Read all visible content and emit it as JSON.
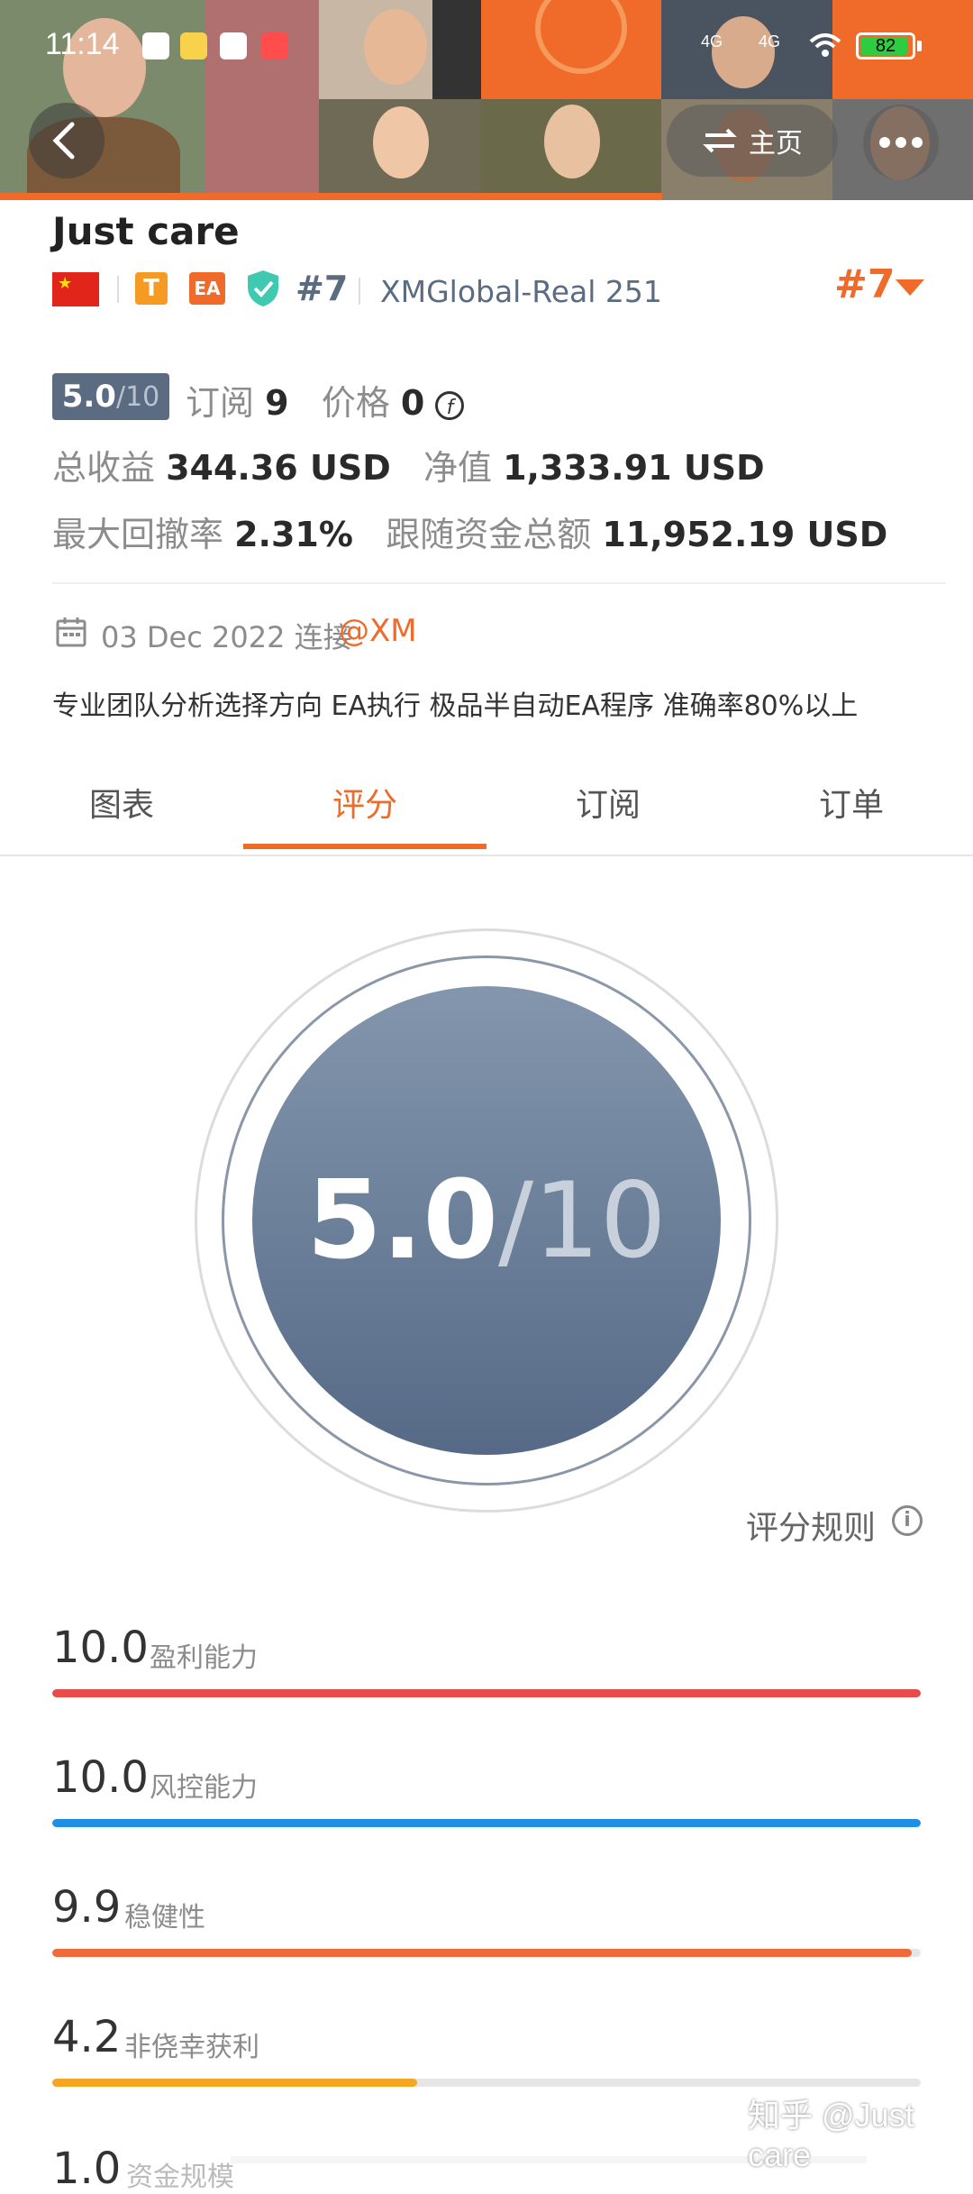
{
  "status_bar": {
    "time": "11:14",
    "network_1": "4G",
    "network_2": "4G",
    "battery": "82"
  },
  "header": {
    "home_label": "主页"
  },
  "profile": {
    "name": "Just care",
    "badge_t": "T",
    "badge_ea": "EA",
    "rank": "#7",
    "server": "XMGlobal-Real 251",
    "rank_right": "#7"
  },
  "stats": {
    "score_value": "5.0",
    "score_denominator": "/10",
    "subscribe_label": "订阅",
    "subscribe_count": "9",
    "price_label": "价格",
    "price_value": "0",
    "price_symbol": "f",
    "total_profit_label": "总收益",
    "total_profit_value": "344.36 USD",
    "equity_label": "净值",
    "equity_value": "1,333.91 USD",
    "max_drawdown_label": "最大回撤率",
    "max_drawdown_value": "2.31%",
    "follow_total_label": "跟随资金总额",
    "follow_total_value": "11,952.19 USD"
  },
  "connection": {
    "date": "03 Dec 2022 连接",
    "broker": "@XM"
  },
  "description": "专业团队分析选择方向 EA执行 极品半自动EA程序 准确率80%以上",
  "tabs": [
    {
      "label": "图表"
    },
    {
      "label": "评分"
    },
    {
      "label": "订阅"
    },
    {
      "label": "订单"
    }
  ],
  "score_circle": {
    "value": "5.0",
    "denominator": "/10"
  },
  "rules_label": "评分规则",
  "scores": [
    {
      "value": "10.0",
      "label": "盈利能力",
      "fraction": 1.0,
      "color": "#e94b4b"
    },
    {
      "value": "10.0",
      "label": "风控能力",
      "fraction": 1.0,
      "color": "#1e8fe6"
    },
    {
      "value": "9.9",
      "label": "稳健性",
      "fraction": 0.99,
      "color": "#f06a3a"
    },
    {
      "value": "4.2",
      "label": "非侥幸获利",
      "fraction": 0.42,
      "color": "#f5a623"
    }
  ],
  "partial_score": {
    "value": "1.0",
    "label": "资金规模"
  },
  "watermark": "知乎 @Just care"
}
